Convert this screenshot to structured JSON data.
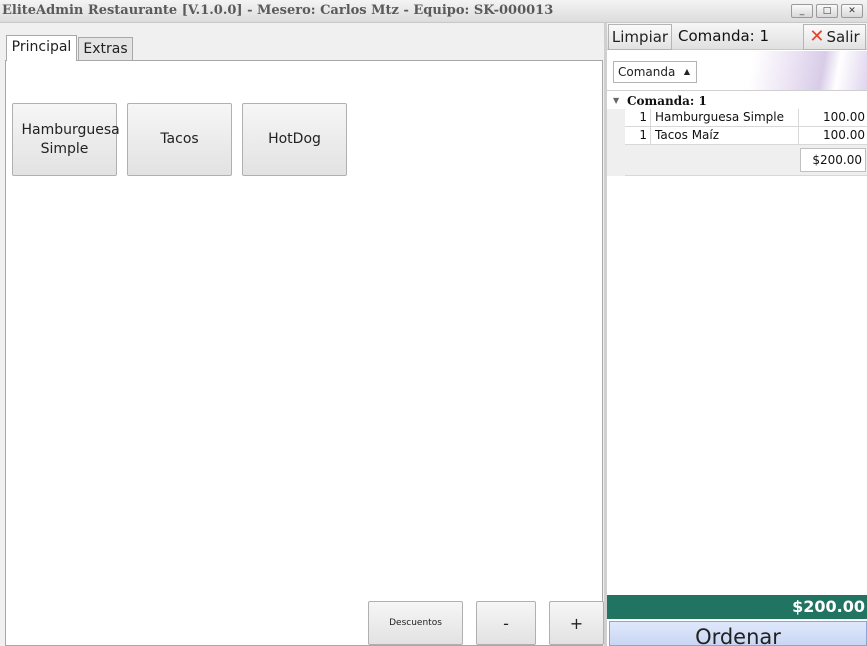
{
  "window": {
    "title": "EliteAdmin Restaurante [V.1.0.0] - Mesero: Carlos Mtz - Equipo: SK-000013",
    "controls": {
      "minimize": "_",
      "maximize": "□",
      "close": "✕"
    }
  },
  "tabs": [
    {
      "label": "Principal",
      "selected": true
    },
    {
      "label": "Extras",
      "selected": false
    }
  ],
  "products": [
    {
      "label": "Hamburguesa Simple"
    },
    {
      "label": "Tacos"
    },
    {
      "label": "HotDog"
    }
  ],
  "actions": {
    "descuentos": "Descuentos",
    "minus": "-",
    "plus": "+"
  },
  "order_panel": {
    "clear_label": "Limpiar",
    "title": "Comanda: 1",
    "exit_label": "Salir",
    "group_by": "Comanda",
    "group_label": "Comanda: 1",
    "items": [
      {
        "qty": "1",
        "desc": "Hamburguesa Simple",
        "amount": "100.00"
      },
      {
        "qty": "1",
        "desc": "Tacos Maíz",
        "amount": "100.00"
      }
    ],
    "subtotal": "$200.00",
    "total": "$200.00",
    "order_label": "Ordenar"
  },
  "colors": {
    "total_bar": "#217462",
    "order_button": "#c9d6f4",
    "exit_icon": "#e8402a"
  }
}
